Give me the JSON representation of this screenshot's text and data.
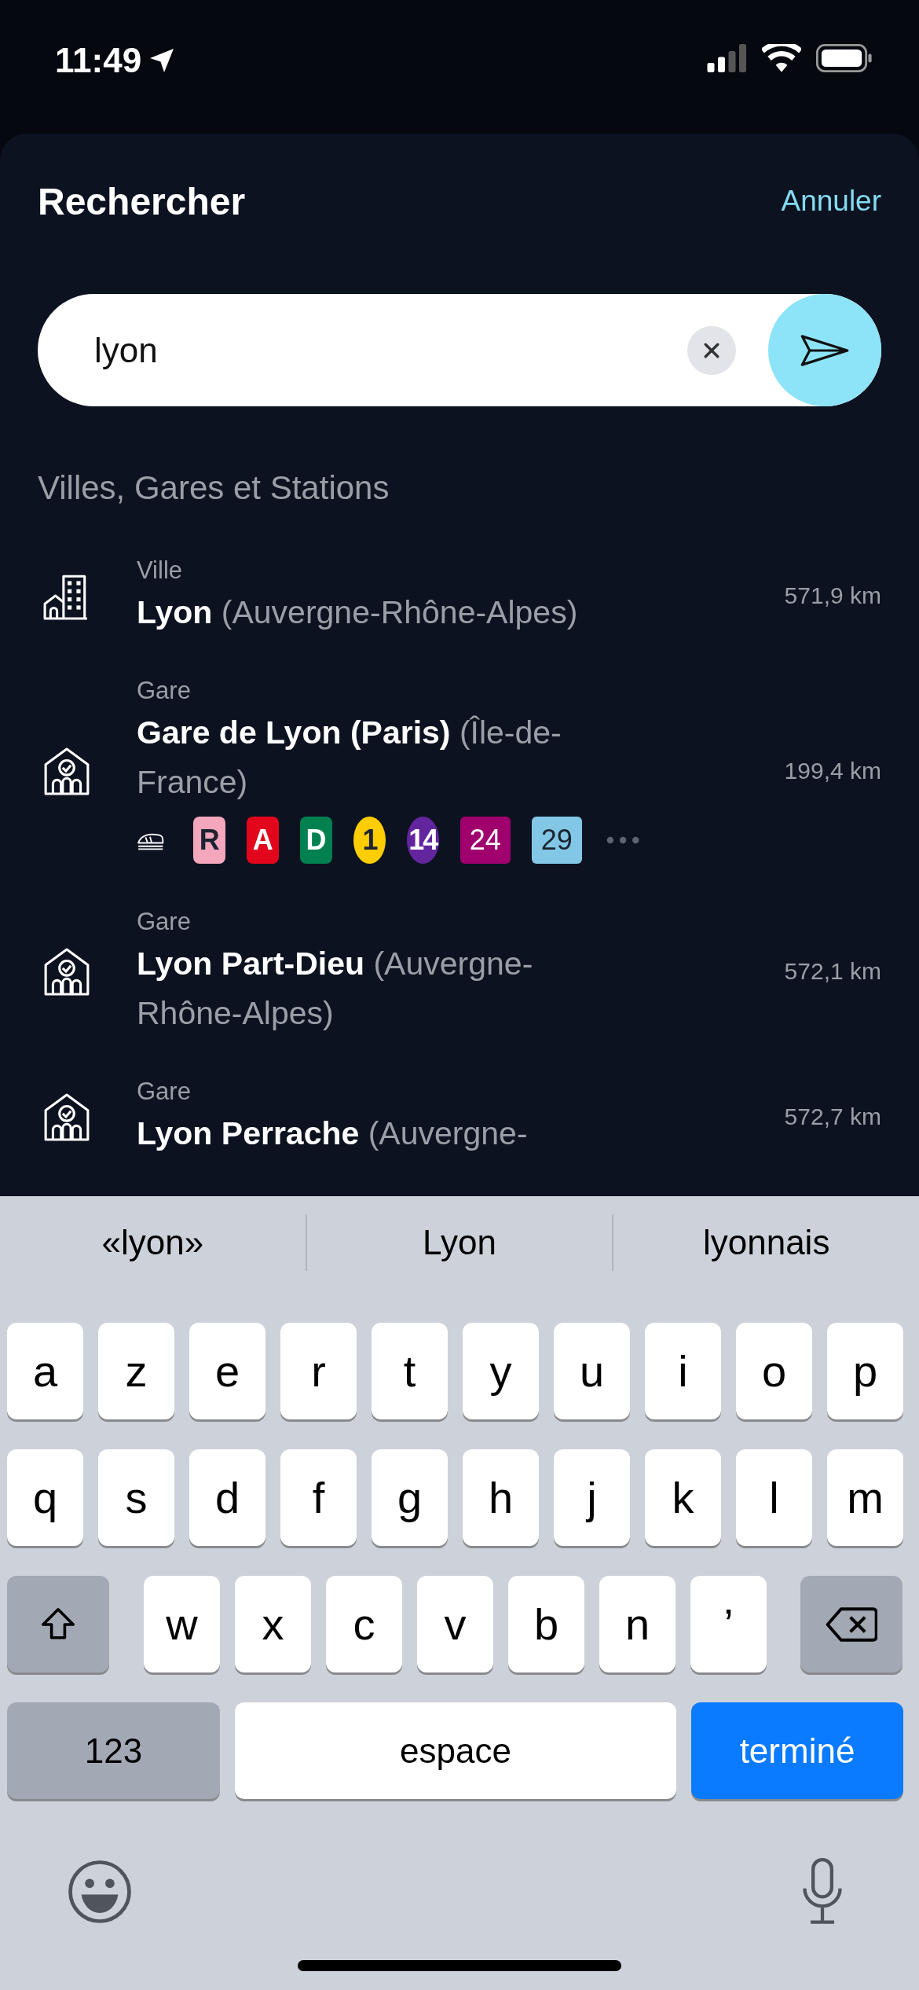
{
  "status_bar": {
    "time": "11:49"
  },
  "header": {
    "title": "Rechercher",
    "cancel": "Annuler"
  },
  "search": {
    "value": "lyon"
  },
  "section_title": "Villes, Gares et Stations",
  "results": [
    {
      "kind": "city",
      "type": "Ville",
      "title": "**Lyon** (Auvergne-Rhône-Alpes)",
      "distance": "571,9 km"
    },
    {
      "kind": "station",
      "type": "Gare",
      "title": "**Gare de Lyon (Paris)** (Île-de-France)",
      "distance": "199,4 km",
      "more": true,
      "lines": [
        {
          "kind": "train"
        },
        {
          "kind": "square",
          "label": "R",
          "color": "#f4a6bd",
          "dark_text": true
        },
        {
          "kind": "square",
          "label": "A",
          "color": "#e3051b",
          "dark_text": false
        },
        {
          "kind": "square",
          "label": "D",
          "color": "#00814f",
          "dark_text": false
        },
        {
          "kind": "circle",
          "label": "1",
          "color": "#ffcd00",
          "dark_text": true
        },
        {
          "kind": "circle",
          "label": "14",
          "color": "#62259d",
          "dark_text": false
        },
        {
          "kind": "wide",
          "label": "24",
          "color": "#a0006e",
          "dark_text": false
        },
        {
          "kind": "wide",
          "label": "29",
          "color": "#82c8e6",
          "dark_text": true
        }
      ]
    },
    {
      "kind": "station",
      "type": "Gare",
      "title": "**Lyon Part-Dieu** (Auvergne-Rhône-Alpes)",
      "distance": "572,1 km"
    },
    {
      "kind": "station",
      "type": "Gare",
      "title": "**Lyon Perrache** (Auvergne-",
      "distance": "572,7 km"
    }
  ],
  "keyboard": {
    "suggestions": [
      "«lyon»",
      "Lyon",
      "lyonnais"
    ],
    "rows": [
      [
        "a",
        "z",
        "e",
        "r",
        "t",
        "y",
        "u",
        "i",
        "o",
        "p"
      ],
      [
        "q",
        "s",
        "d",
        "f",
        "g",
        "h",
        "j",
        "k",
        "l",
        "m"
      ],
      [
        "w",
        "x",
        "c",
        "v",
        "b",
        "n",
        "’"
      ]
    ],
    "numbers_key": "123",
    "space_key": "espace",
    "return_key": "terminé"
  }
}
